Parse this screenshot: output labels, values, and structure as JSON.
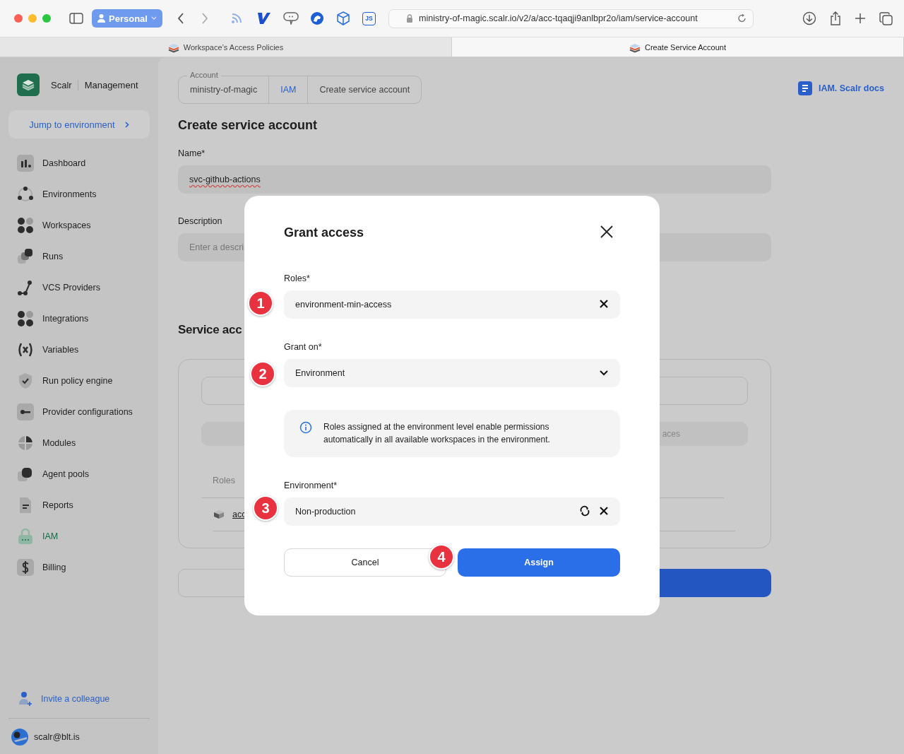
{
  "browser": {
    "profile": "Personal",
    "js_badge": "JS",
    "url": "ministry-of-magic.scalr.io/v2/a/acc-tqaqji9anlbpr2o/iam/service-account",
    "tabs": [
      {
        "title": "Workspace’s Access Policies",
        "selected": false
      },
      {
        "title": "Create Service Account",
        "selected": true
      }
    ]
  },
  "sidebar": {
    "brand": "Scalr",
    "section": "Management",
    "jump": "Jump to environment",
    "items": [
      {
        "label": "Dashboard",
        "selected": false
      },
      {
        "label": "Environments",
        "selected": false
      },
      {
        "label": "Workspaces",
        "selected": false
      },
      {
        "label": "Runs",
        "selected": false
      },
      {
        "label": "VCS Providers",
        "selected": false
      },
      {
        "label": "Integrations",
        "selected": false
      },
      {
        "label": "Variables",
        "selected": false
      },
      {
        "label": "Run policy engine",
        "selected": false
      },
      {
        "label": "Provider configurations",
        "selected": false
      },
      {
        "label": "Modules",
        "selected": false
      },
      {
        "label": "Agent pools",
        "selected": false
      },
      {
        "label": "Reports",
        "selected": false
      },
      {
        "label": "IAM",
        "selected": true
      },
      {
        "label": "Billing",
        "selected": false
      }
    ],
    "invite": "Invite a colleague",
    "user": "scalr@blt.is"
  },
  "main": {
    "breadcrumb": {
      "label": "Account",
      "items": [
        {
          "label": "ministry-of-magic",
          "kind": "text"
        },
        {
          "label": "IAM",
          "kind": "link"
        },
        {
          "label": "Create service account",
          "kind": "text"
        }
      ]
    },
    "docs_link": "IAM. Scalr docs",
    "title": "Create service account",
    "name_field": {
      "label": "Name*",
      "value": "svc-github-actions"
    },
    "description_field": {
      "label": "Description",
      "placeholder": "Enter a descri"
    },
    "section_title": "Service acc",
    "segment_text": "aces",
    "table_header": "Roles",
    "row_link": "acc"
  },
  "modal": {
    "title": "Grant access",
    "fields": [
      {
        "kind": "clear",
        "label": "Roles*",
        "value": "environment-min-access",
        "marker": "1"
      },
      {
        "kind": "dropdown",
        "label": "Grant on*",
        "value": "Environment",
        "marker": "2"
      },
      {
        "kind": "info",
        "text": "Roles assigned at the environment level enable permissions automatically in all available workspaces in the environment."
      },
      {
        "kind": "refresh",
        "label": "Environment*",
        "value": "Non-production",
        "marker": "3"
      }
    ],
    "cancel": "Cancel",
    "assign": "Assign",
    "assign_marker": "4"
  }
}
